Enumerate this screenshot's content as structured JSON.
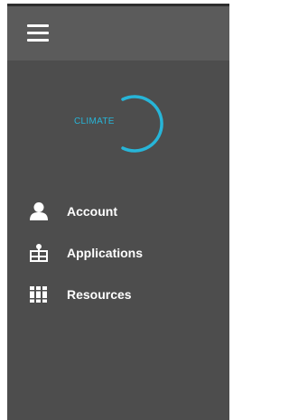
{
  "header": {
    "menu_icon": "hamburger-menu-icon"
  },
  "brand": {
    "logo_text": "CLIMATE",
    "accent_color": "#27b5d8"
  },
  "sidebar": {
    "items": [
      {
        "label": "Account",
        "icon": "user-icon"
      },
      {
        "label": "Applications",
        "icon": "applications-icon"
      },
      {
        "label": "Resources",
        "icon": "books-icon"
      }
    ]
  },
  "colors": {
    "panel_bg": "#4d4d4d",
    "topbar_bg": "#5b5b5b",
    "text": "#ffffff"
  }
}
